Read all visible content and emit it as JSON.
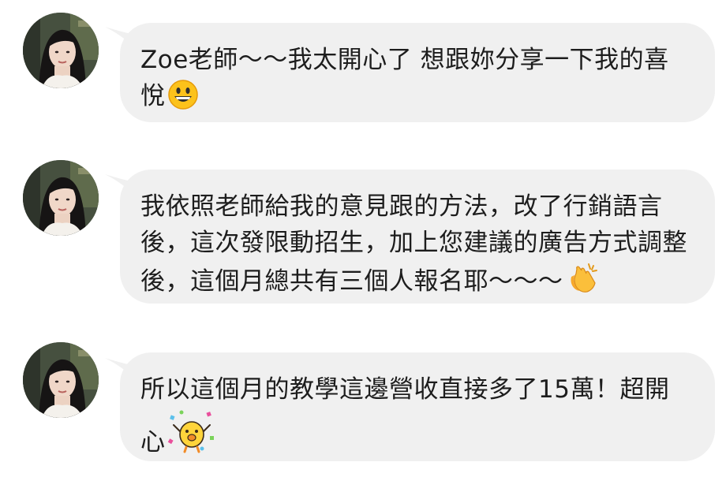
{
  "messages": [
    {
      "text": "Zoe老師～～我太開心了 想跟妳分享一下我的喜悅",
      "emoji": "grinning-face-icon"
    },
    {
      "text": "我依照老師給我的意見跟的方法，改了行銷語言後，這次發限動招生，加上您建議的廣告方式調整後，這個月總共有三個人報名耶～～～",
      "emoji": "clapping-hands-icon"
    },
    {
      "text": "所以這個月的教學這邊營收直接多了15萬！超開心",
      "emoji": "celebrating-chick-sticker-icon"
    }
  ],
  "colors": {
    "bubble": "#f0f0f0",
    "text": "#1d1d1d",
    "background": "#ffffff"
  }
}
